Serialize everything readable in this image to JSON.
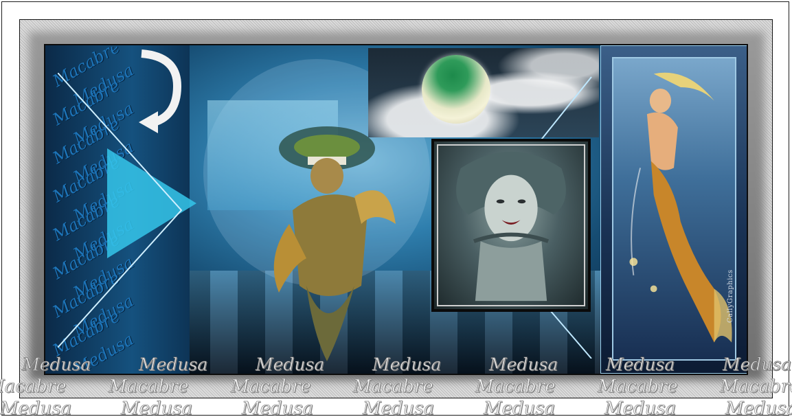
{
  "artwork": {
    "left_stack_words": [
      "Macabre",
      "Medusa",
      "Macabre",
      "Medusa",
      "Macabre",
      "Medusa",
      "Macabre",
      "Medusa",
      "Macabre",
      "Medusa",
      "Macabre",
      "Medusa",
      "Macabre",
      "Medusa",
      "Macabre",
      "Medusa"
    ],
    "signature": "CallyGraphics",
    "bottom_row_1": [
      "Medusa",
      "Medusa",
      "Medusa",
      "Medusa",
      "Medusa",
      "Medusa",
      "Medusa"
    ],
    "bottom_row_2": [
      "Macabre",
      "Macabre",
      "Macabre",
      "Macabre",
      "Macabre",
      "Macabre",
      "Macabre"
    ],
    "bottom_row_3": [
      "Medusa",
      "Medusa",
      "Medusa",
      "Medusa",
      "Medusa",
      "Medusa",
      "Medusa"
    ]
  },
  "colors": {
    "frame": "#111111",
    "band": "#cccccc",
    "accent_cyan": "#35c6ea",
    "deep_blue": "#0a2640",
    "moon_green": "#1d8a4b"
  },
  "icons": [
    "curved-arrow-icon"
  ]
}
